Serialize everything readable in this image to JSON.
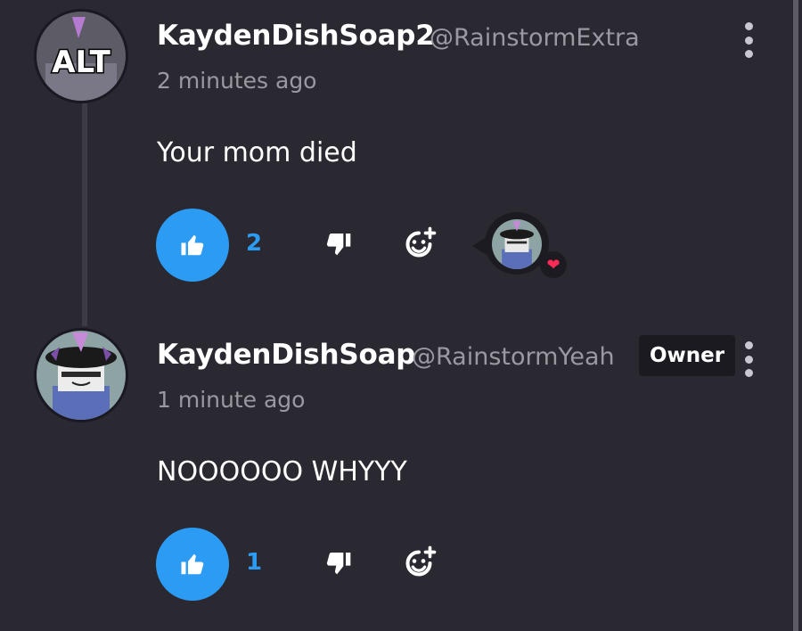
{
  "comments": [
    {
      "username": "KaydenDishSoap2",
      "handle": "@RainstormExtra",
      "timestamp": "2 minutes ago",
      "text": "Your mom died",
      "likes": "2",
      "avatar_label": "ALT",
      "reaction": "heart-icon"
    },
    {
      "username": "KaydenDishSoap",
      "handle": "@RainstormYeah",
      "badge": "Owner",
      "timestamp": "1 minute ago",
      "text": "NOOOOOO WHYYY",
      "likes": "1"
    }
  ],
  "colors": {
    "background": "#2a2830",
    "accent": "#2b9bf3",
    "heart": "#ff2a55",
    "muted_text": "#9a98a0"
  },
  "icons": {
    "like": "thumbs-up-icon",
    "dislike": "thumbs-down-icon",
    "react": "add-reaction-icon",
    "menu": "kebab-menu-icon"
  }
}
